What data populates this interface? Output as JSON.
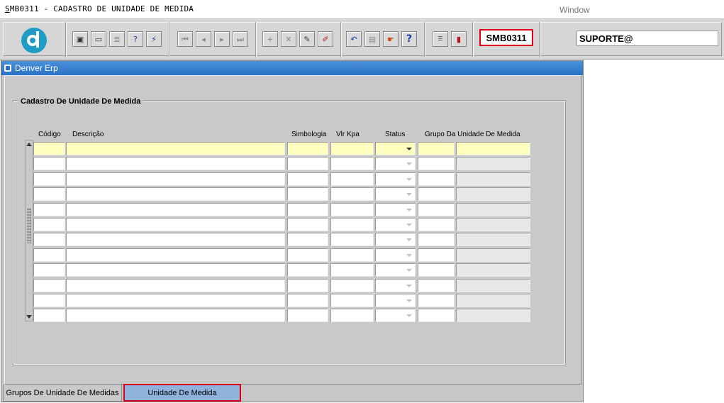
{
  "menubar": {
    "title_prefix": "S",
    "title_rest": "MB0311 - CADASTRO DE UNIDADE DE MEDIDA",
    "window_menu": "Window"
  },
  "toolbar": {
    "form_code": "SMB0311",
    "user": "SUPORTE@",
    "icons": [
      "save-icon",
      "print-preview-icon",
      "print-icon",
      "query-help-icon",
      "execute-query-icon",
      "first-record-icon",
      "previous-record-icon",
      "next-record-icon",
      "last-record-icon",
      "insert-record-icon",
      "delete-record-icon",
      "edit-record-icon",
      "clear-icon",
      "undo-icon",
      "paste-icon",
      "tools-icon",
      "help-icon",
      "menu-icon",
      "exit-icon"
    ]
  },
  "window": {
    "title": "Denver Erp"
  },
  "frame": {
    "title": "Cadastro De Unidade De Medida",
    "columns": {
      "codigo": "Código",
      "descricao": "Descrição",
      "simbologia": "Simbologia",
      "vlr_kpa": "Vlr Kpa",
      "status": "Status",
      "grupo": "Grupo Da Unidade De Medida"
    },
    "row_count": 12
  },
  "tabs": {
    "grupos": "Grupos De Unidade De Medidas",
    "unidade": "Unidade De Medida"
  },
  "colors": {
    "current_row": "#ffffc0",
    "highlight_border": "#e0001b",
    "title_bar": "#2a72c4",
    "active_tab": "#8fb3dd"
  }
}
